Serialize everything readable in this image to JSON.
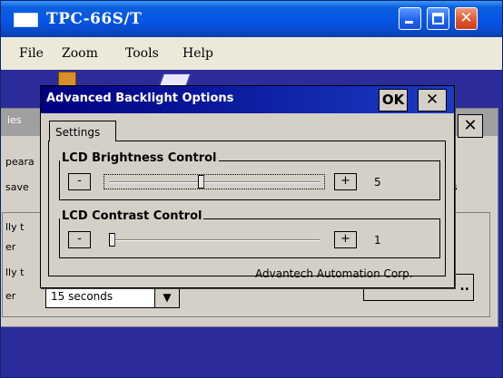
{
  "window": {
    "title": "TPC-66S/T"
  },
  "menu": {
    "file": "File",
    "zoom": "Zoom",
    "tools": "Tools",
    "help": "Help"
  },
  "background_window": {
    "tab_fragment": "ies",
    "text_fragments": [
      "peara",
      "save",
      "lly t",
      "er",
      "lly t",
      "er"
    ],
    "select_value": "15 seconds",
    "button_label": "..",
    "fragment_s": "s"
  },
  "dialog": {
    "title": "Advanced Backlight Options",
    "ok_label": "OK",
    "close_label": "✕",
    "tab_label": "Settings",
    "brightness": {
      "label": "LCD Brightness Control",
      "minus": "-",
      "plus": "+",
      "value": "5",
      "level": 5
    },
    "contrast": {
      "label": "LCD Contrast Control",
      "minus": "-",
      "plus": "+",
      "value": "1",
      "level": 1
    },
    "footer": "Advantech Automation Corp."
  },
  "colors": {
    "xp_title_blue": "#0555e6",
    "dialog_title_blue": "#000080",
    "desktop_blue": "#2b2b9b",
    "face_gray": "#d4d0c8"
  }
}
